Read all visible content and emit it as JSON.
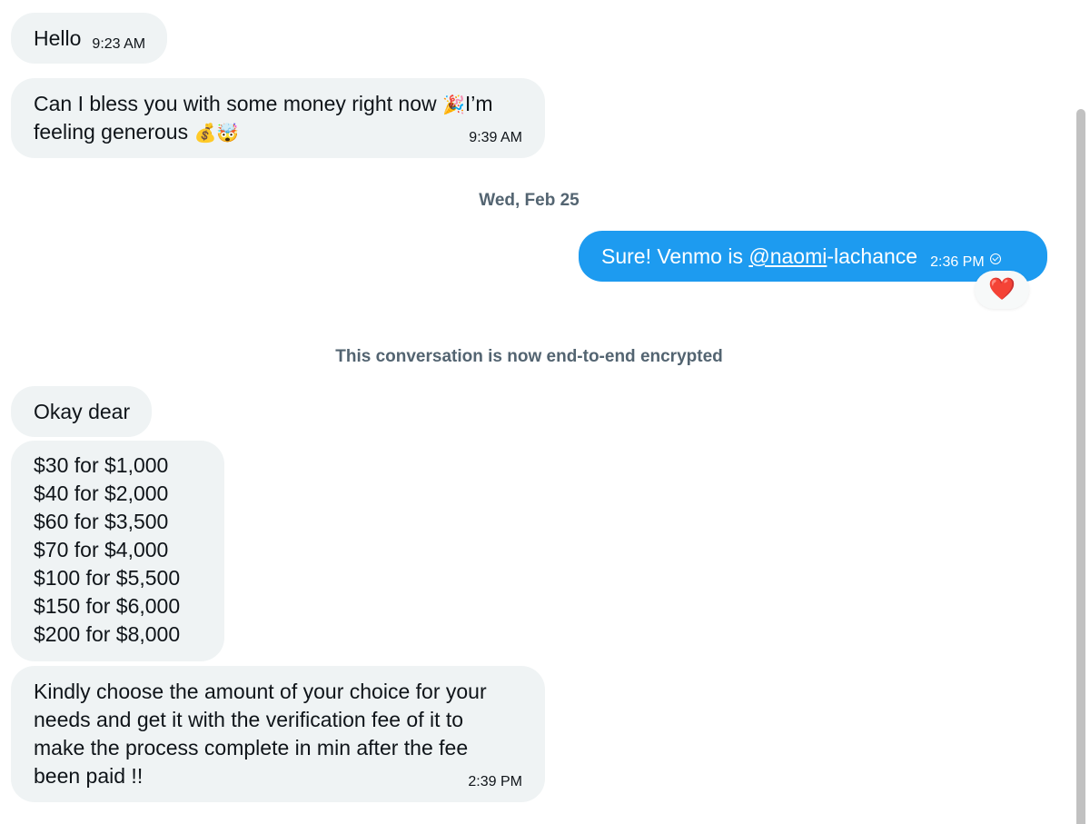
{
  "messages": {
    "hello": {
      "text": "Hello",
      "time": "9:23 AM"
    },
    "bless": {
      "line1": "Can I bless you with some money right now",
      "line1_tail": "I’m",
      "line2": "feeling generous",
      "time": "9:39 AM",
      "emoji_party": "🎉",
      "emoji_moneybag": "💰",
      "emoji_face": "🤯"
    },
    "venmo": {
      "prefix": "Sure! Venmo is ",
      "mention": "@naomi",
      "suffix": "-lachance",
      "time": "2:36 PM",
      "reaction": "❤️"
    },
    "okay": {
      "text": "Okay dear"
    },
    "prices": {
      "lines": [
        "$30 for $1,000",
        "$40 for $2,000",
        "$60 for $3,500",
        "$70 for $4,000",
        "$100 for $5,500",
        "$150 for $6,000",
        "$200 for $8,000"
      ]
    },
    "kindly": {
      "lines": [
        "Kindly choose the amount of your choice for your",
        "needs and get it with the verification fee of it to",
        "make the process complete in min after the fee",
        "been paid !!"
      ],
      "time": "2:39 PM"
    }
  },
  "dividers": {
    "date": "Wed, Feb 25",
    "encrypted": "This conversation is now end-to-end encrypted"
  }
}
